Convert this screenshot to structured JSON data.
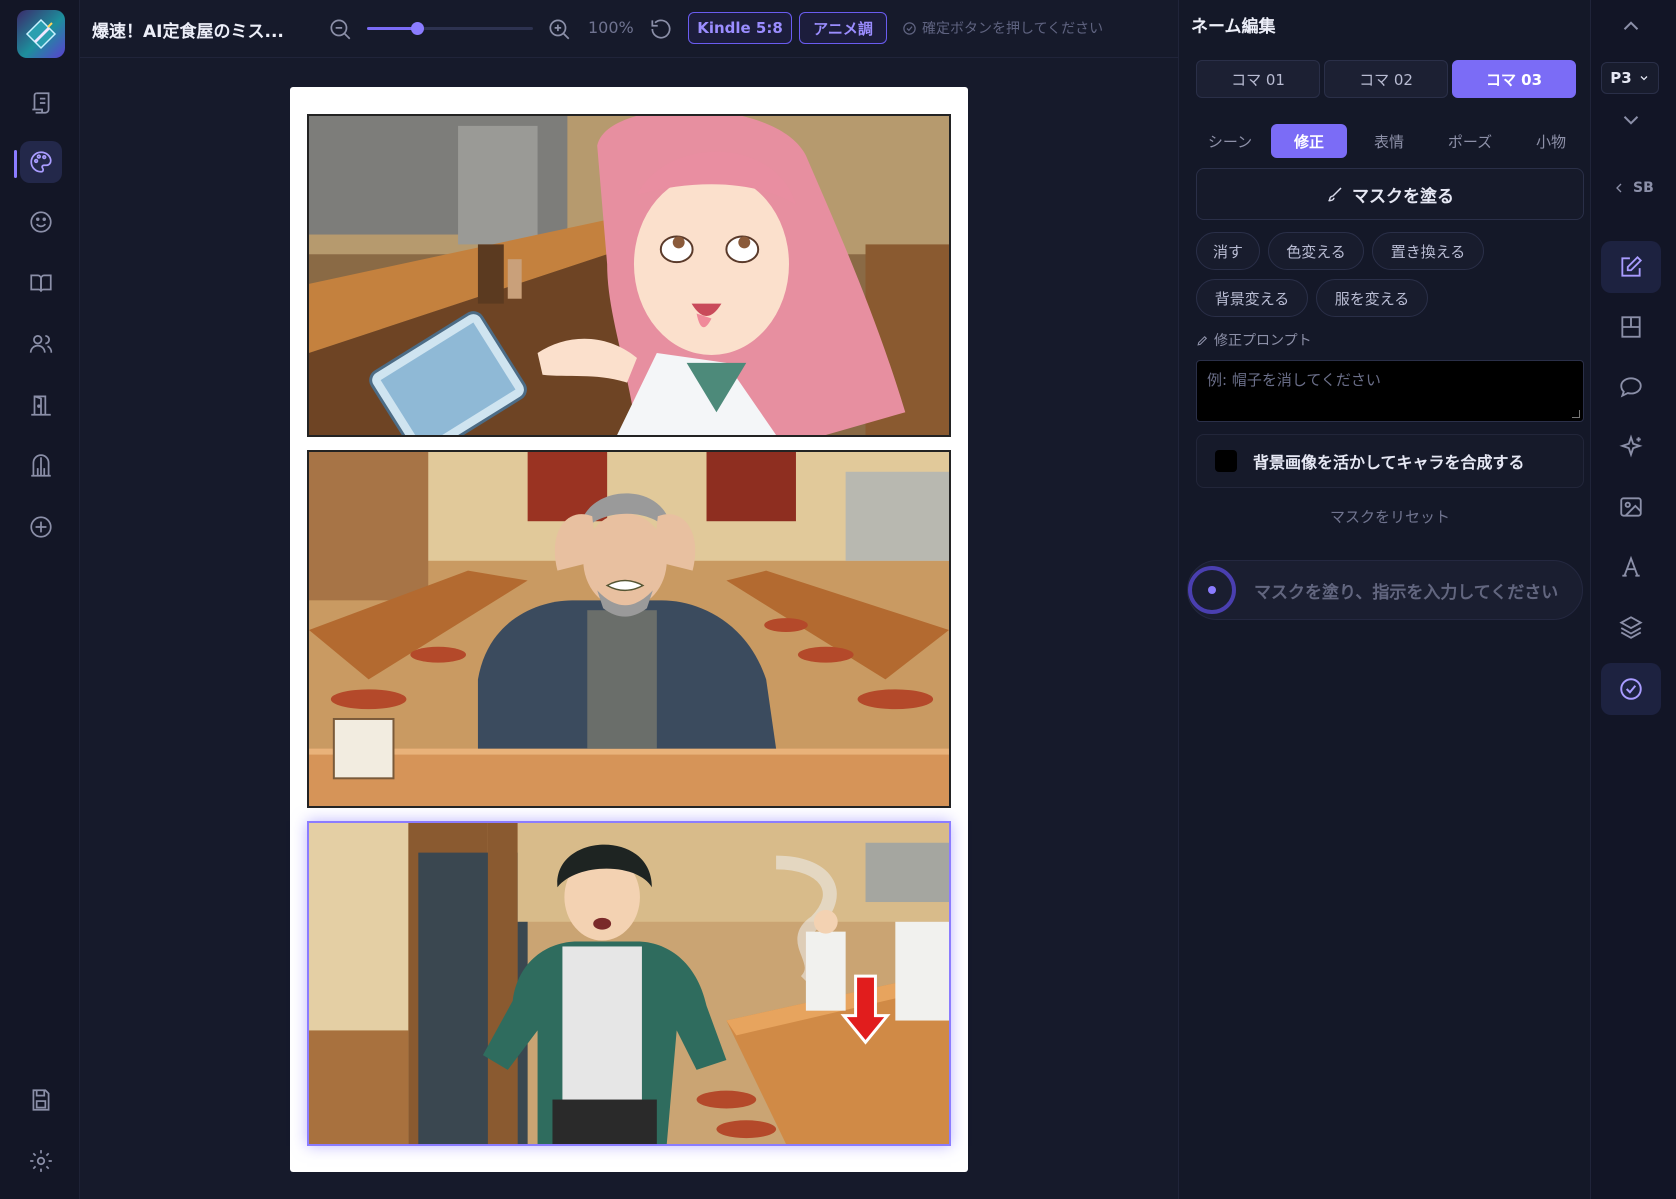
{
  "app": {
    "project_title": "爆速！AI定食屋のミス...",
    "logo_icon": "diamond-pen-logo"
  },
  "toolbar": {
    "zoom_value": "100%",
    "zoom_level": 0.3,
    "size_chip": "Kindle 5:8",
    "style_chip": "アニメ調",
    "confirm_hint": "確定ボタンを押してください"
  },
  "left_rail": {
    "items": [
      {
        "name": "script-icon"
      },
      {
        "name": "palette-icon",
        "active": true
      },
      {
        "name": "smile-icon"
      },
      {
        "name": "book-icon"
      },
      {
        "name": "users-icon"
      },
      {
        "name": "door-icon"
      },
      {
        "name": "gate-icon"
      },
      {
        "name": "plus-circle-icon"
      },
      {
        "name": "save-icon"
      },
      {
        "name": "gear-icon"
      }
    ]
  },
  "canvas": {
    "panels": [
      {
        "name": "panel-1"
      },
      {
        "name": "panel-2"
      },
      {
        "name": "panel-3",
        "selected": true
      }
    ]
  },
  "editor": {
    "heading": "ネーム編集",
    "koma_tabs": [
      "コマ 01",
      "コマ 02",
      "コマ 03"
    ],
    "active_koma": 2,
    "sub_tabs": [
      "シーン",
      "修正",
      "表情",
      "ポーズ",
      "小物"
    ],
    "active_sub_tab": 1,
    "paint_mask_label": "マスクを塗る",
    "quick_actions": [
      "消す",
      "色変える",
      "置き換える",
      "背景変える",
      "服を変える"
    ],
    "prompt_label": "修正プロンプト",
    "prompt_placeholder": "例: 帽子を消してください",
    "prompt_value": "",
    "composite_label": "背景画像を活かしてキャラを合成する",
    "composite_checked": false,
    "reset_mask_label": "マスクをリセット",
    "status_text": "マスクを塗り、指示を入力してください"
  },
  "right_rail": {
    "page_select": "P3",
    "sb_label": "SB",
    "items": [
      {
        "name": "edit-icon",
        "active": true
      },
      {
        "name": "layout-icon"
      },
      {
        "name": "speech-bubble-icon"
      },
      {
        "name": "sparkle-icon"
      },
      {
        "name": "image-icon"
      },
      {
        "name": "text-style-icon"
      },
      {
        "name": "layers-icon"
      },
      {
        "name": "check-circle-icon",
        "active": true
      }
    ]
  },
  "colors": {
    "accent": "#7b6cf6",
    "background": "#161a2b",
    "panel": "#141828"
  }
}
